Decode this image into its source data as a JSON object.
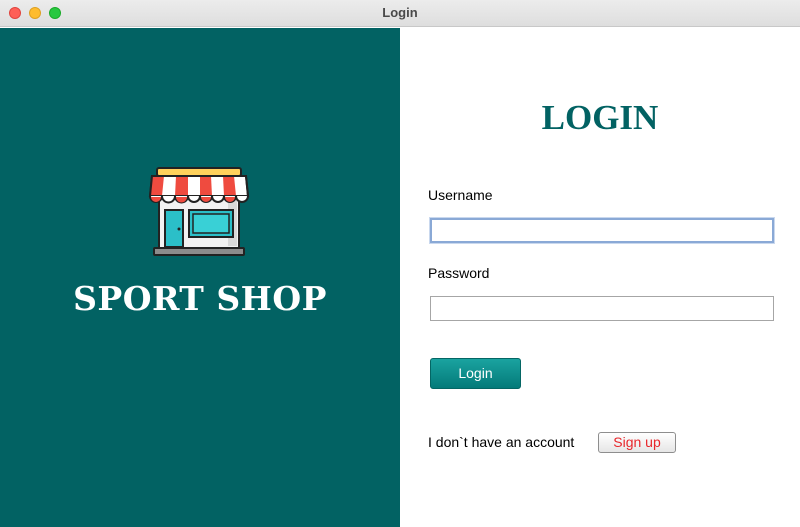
{
  "window": {
    "title": "Login"
  },
  "brand": {
    "icon": "shop-storefront-icon",
    "name": "SPORT SHOP",
    "panel_color": "#026263"
  },
  "form": {
    "heading": "LOGIN",
    "username_label": "Username",
    "username_value": "",
    "password_label": "Password",
    "password_value": "",
    "login_button": "Login",
    "no_account_text": "I don`t have an account",
    "signup_button": "Sign up"
  },
  "colors": {
    "accent": "#026263",
    "signup_text": "#e8262b"
  }
}
